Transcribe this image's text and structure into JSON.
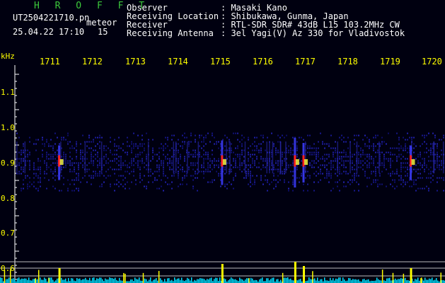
{
  "brand": "H R O F F T",
  "file_name": "UT2504221710.pn",
  "file_suffix": "meteor",
  "datetime": "25.04.22 17:10",
  "frame_number": "15",
  "metadata": [
    {
      "label": "Observer",
      "value": ": Masaki Kano"
    },
    {
      "label": "Receiving Location",
      "value": ": Shibukawa, Gunma, Japan"
    },
    {
      "label": "Receiver",
      "value": ": RTL-SDR SDR# 43dB L15 103.2MHz CW"
    },
    {
      "label": "Receiving Antenna",
      "value": ": 3el Yagi(V) Az 330 for Vladivostok"
    }
  ],
  "unit_label": "kHz",
  "time_ticks": [
    "1711",
    "1712",
    "1713",
    "1714",
    "1715",
    "1716",
    "1717",
    "1718",
    "1719",
    "1720"
  ],
  "freq_ticks": [
    "1.1",
    "1.0",
    "0.9",
    "0.8",
    "0.7",
    "0.6"
  ],
  "colors": {
    "background": "#000010",
    "ticks": "#ffff00",
    "brand": "#3cc93c",
    "signal_low": "#1a1a8c",
    "signal_high": "#ff2020",
    "level_trace": "#00e0ff",
    "level_peaks": "#ffff00"
  },
  "events": [
    {
      "time_min": 1711.6,
      "strength": 0.7
    },
    {
      "time_min": 1715.4,
      "strength": 0.9
    },
    {
      "time_min": 1717.1,
      "strength": 1.0
    },
    {
      "time_min": 1717.3,
      "strength": 0.8
    },
    {
      "time_min": 1719.8,
      "strength": 0.7
    }
  ]
}
